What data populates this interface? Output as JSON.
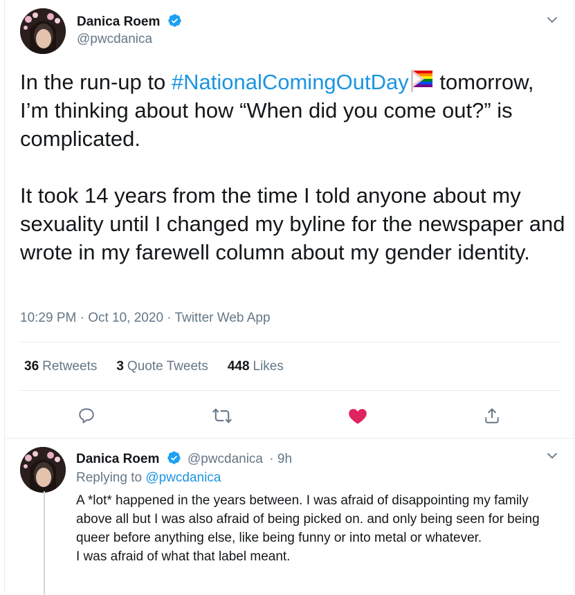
{
  "tweet": {
    "author_name": "Danica Roem",
    "author_handle": "@pwcdanica",
    "text_part1": "In the run-up to ",
    "hashtag": "#NationalComingOutDay",
    "text_part2": " tomorrow, I’m thinking about how “When did you come out?” is complicated.\n\nIt took 14 years from the time I told anyone about my sexuality until I changed my byline for the newspaper and wrote in my farewell column about my gender identity.",
    "timestamp": "10:29 PM · Oct 10, 2020 · Twitter Web App",
    "stats": {
      "retweets_count": "36",
      "retweets_label": "Retweets",
      "quotes_count": "3",
      "quotes_label": "Quote Tweets",
      "likes_count": "448",
      "likes_label": "Likes"
    },
    "actions": {
      "reply_icon": "reply-icon",
      "retweet_icon": "retweet-icon",
      "like_icon": "heart-icon",
      "share_icon": "share-icon"
    }
  },
  "reply": {
    "author_name": "Danica Roem",
    "author_handle": "@pwcdanica",
    "time_ago": "· 9h",
    "replying_label": "Replying to",
    "replying_handle": "@pwcdanica",
    "text_line1": "A *lot* happened in the years between. I was afraid of disappointing my family above all but I was also afraid of being picked on. and only being seen for being queer before anything else, like being funny or into metal or whatever.",
    "text_line2": "I was afraid of what that label meant."
  },
  "colors": {
    "accent": "#1b95e0",
    "verified": "#1da1f2",
    "liked": "#e0245e",
    "muted": "#657786",
    "text": "#14171a"
  }
}
